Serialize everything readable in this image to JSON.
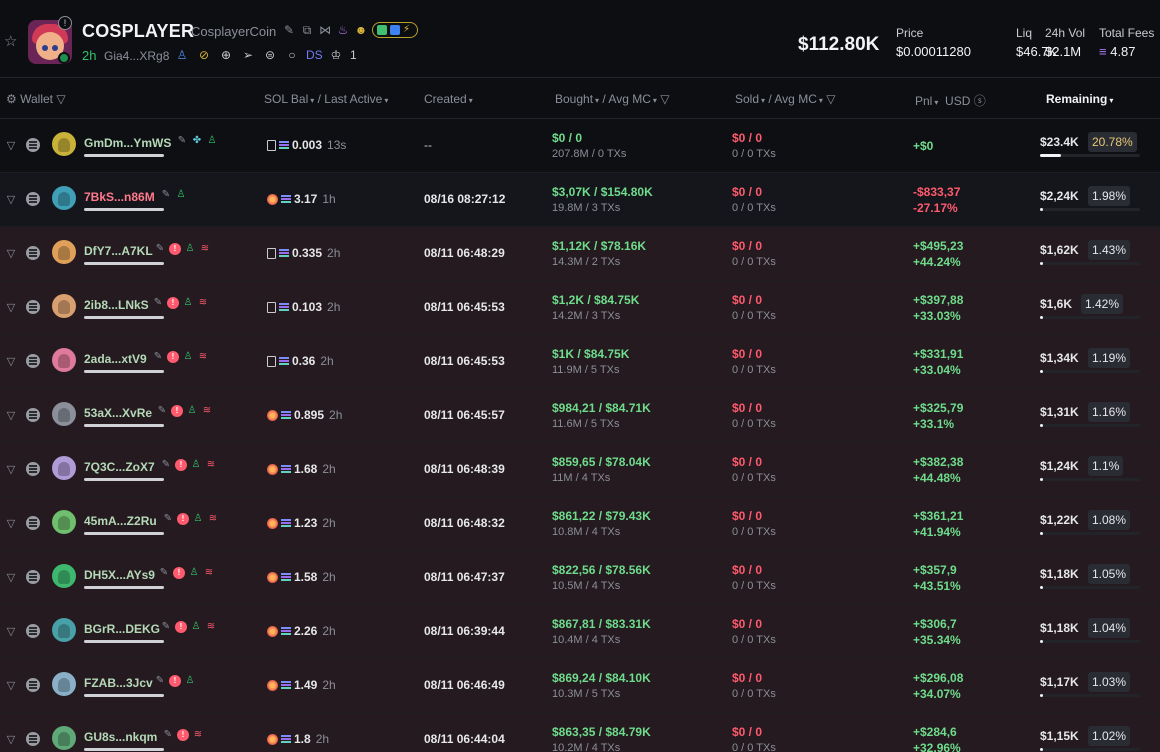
{
  "token": {
    "ticker": "COSPLAYER",
    "full_name": "CosplayerCoin",
    "age": "2h",
    "address": "Gia4...XRg8",
    "ds_label": "DS",
    "crown_count": "1"
  },
  "stats": {
    "market_cap": "$112.80K",
    "price_label": "Price",
    "price_value": "$0.00011280",
    "liq_label": "Liq",
    "liq_value": "$46.7K",
    "vol_label": "24h Vol",
    "vol_value": "$2.1M",
    "fees_label": "Total Fees",
    "fees_value": "4.87"
  },
  "columns": {
    "wallet": "Wallet",
    "sol_bal": "SOL Bal",
    "last_active": "/ Last Active",
    "created": "Created",
    "bought": "Bought",
    "bought_mc": "/ Avg MC",
    "sold": "Sold",
    "sold_mc": "/ Avg MC",
    "pnl": "Pnl",
    "usd": "USD",
    "remaining": "Remaining"
  },
  "rows": [
    {
      "wallet": "GmDm...YmWS",
      "sol": "0.003",
      "age": "13s",
      "created": "--",
      "bought": "$0 / 0",
      "bought_sub": "207.8M / 0 TXs",
      "sold": "$0 / 0",
      "sold_sub": "0 / 0 TXs",
      "pnl": "+$0",
      "pnl_pct": "",
      "remaining": "$23.4K",
      "pct": "20.78%",
      "fill": 0.2078
    },
    {
      "wallet": "7BkS...n86M",
      "sol": "3.17",
      "age": "1h",
      "created": "08/16 08:27:12",
      "bought": "$3,07K / $154.80K",
      "bought_sub": "19.8M / 3 TXs",
      "sold": "$0 / 0",
      "sold_sub": "0 / 0 TXs",
      "pnl": "-$833,37",
      "pnl_pct": "-27.17%",
      "remaining": "$2,24K",
      "pct": "1.98%",
      "fill": 0.0198
    },
    {
      "wallet": "DfY7...A7KL",
      "sol": "0.335",
      "age": "2h",
      "created": "08/11 06:48:29",
      "bought": "$1,12K / $78.16K",
      "bought_sub": "14.3M / 2 TXs",
      "sold": "$0 / 0",
      "sold_sub": "0 / 0 TXs",
      "pnl": "+$495,23",
      "pnl_pct": "+44.24%",
      "remaining": "$1,62K",
      "pct": "1.43%",
      "fill": 0.0143
    },
    {
      "wallet": "2ib8...LNkS",
      "sol": "0.103",
      "age": "2h",
      "created": "08/11 06:45:53",
      "bought": "$1,2K / $84.75K",
      "bought_sub": "14.2M / 3 TXs",
      "sold": "$0 / 0",
      "sold_sub": "0 / 0 TXs",
      "pnl": "+$397,88",
      "pnl_pct": "+33.03%",
      "remaining": "$1,6K",
      "pct": "1.42%",
      "fill": 0.0142
    },
    {
      "wallet": "2ada...xtV9",
      "sol": "0.36",
      "age": "2h",
      "created": "08/11 06:45:53",
      "bought": "$1K / $84.75K",
      "bought_sub": "11.9M / 5 TXs",
      "sold": "$0 / 0",
      "sold_sub": "0 / 0 TXs",
      "pnl": "+$331,91",
      "pnl_pct": "+33.04%",
      "remaining": "$1,34K",
      "pct": "1.19%",
      "fill": 0.0119
    },
    {
      "wallet": "53aX...XvRe",
      "sol": "0.895",
      "age": "2h",
      "created": "08/11 06:45:57",
      "bought": "$984,21 / $84.71K",
      "bought_sub": "11.6M / 5 TXs",
      "sold": "$0 / 0",
      "sold_sub": "0 / 0 TXs",
      "pnl": "+$325,79",
      "pnl_pct": "+33.1%",
      "remaining": "$1,31K",
      "pct": "1.16%",
      "fill": 0.0116
    },
    {
      "wallet": "7Q3C...ZoX7",
      "sol": "1.68",
      "age": "2h",
      "created": "08/11 06:48:39",
      "bought": "$859,65 / $78.04K",
      "bought_sub": "11M / 4 TXs",
      "sold": "$0 / 0",
      "sold_sub": "0 / 0 TXs",
      "pnl": "+$382,38",
      "pnl_pct": "+44.48%",
      "remaining": "$1,24K",
      "pct": "1.1%",
      "fill": 0.011
    },
    {
      "wallet": "45mA...Z2Ru",
      "sol": "1.23",
      "age": "2h",
      "created": "08/11 06:48:32",
      "bought": "$861,22 / $79.43K",
      "bought_sub": "10.8M / 4 TXs",
      "sold": "$0 / 0",
      "sold_sub": "0 / 0 TXs",
      "pnl": "+$361,21",
      "pnl_pct": "+41.94%",
      "remaining": "$1,22K",
      "pct": "1.08%",
      "fill": 0.0108
    },
    {
      "wallet": "DH5X...AYs9",
      "sol": "1.58",
      "age": "2h",
      "created": "08/11 06:47:37",
      "bought": "$822,56 / $78.56K",
      "bought_sub": "10.5M / 4 TXs",
      "sold": "$0 / 0",
      "sold_sub": "0 / 0 TXs",
      "pnl": "+$357,9",
      "pnl_pct": "+43.51%",
      "remaining": "$1,18K",
      "pct": "1.05%",
      "fill": 0.0105
    },
    {
      "wallet": "BGrR...DEKG",
      "sol": "2.26",
      "age": "2h",
      "created": "08/11 06:39:44",
      "bought": "$867,81 / $83.31K",
      "bought_sub": "10.4M / 4 TXs",
      "sold": "$0 / 0",
      "sold_sub": "0 / 0 TXs",
      "pnl": "+$306,7",
      "pnl_pct": "+35.34%",
      "remaining": "$1,18K",
      "pct": "1.04%",
      "fill": 0.0104
    },
    {
      "wallet": "FZAB...3Jcv",
      "sol": "1.49",
      "age": "2h",
      "created": "08/11 06:46:49",
      "bought": "$869,24 / $84.10K",
      "bought_sub": "10.3M / 5 TXs",
      "sold": "$0 / 0",
      "sold_sub": "0 / 0 TXs",
      "pnl": "+$296,08",
      "pnl_pct": "+34.07%",
      "remaining": "$1,17K",
      "pct": "1.03%",
      "fill": 0.0103
    },
    {
      "wallet": "GU8s...nkqm",
      "sol": "1.8",
      "age": "2h",
      "created": "08/11 06:44:04",
      "bought": "$863,35 / $84.79K",
      "bought_sub": "10.2M / 4 TXs",
      "sold": "$0 / 0",
      "sold_sub": "0 / 0 TXs",
      "pnl": "+$284,6",
      "pnl_pct": "+32.96%",
      "remaining": "$1,15K",
      "pct": "1.02%",
      "fill": 0.0102
    }
  ],
  "colors": {
    "positive": "#6fdc8c",
    "negative": "#ff5a6e",
    "row_highlight": "#241a1f",
    "accent_sol": "#a77cf2"
  }
}
